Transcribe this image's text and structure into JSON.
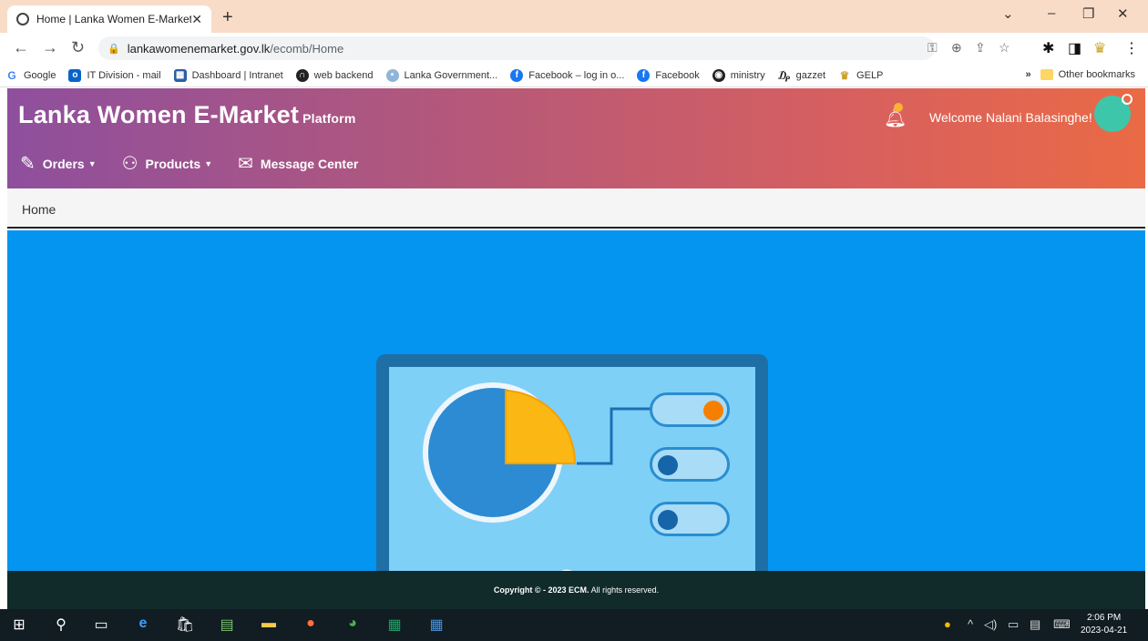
{
  "browser": {
    "tab_title": "Home | Lanka Women E-Market",
    "url_host": "lankawomenemarket.gov.lk",
    "url_path": "/ecomb/Home",
    "bookmarks": [
      "Google",
      "IT Division - mail",
      "Dashboard | Intranet",
      "web backend",
      "Lanka Government...",
      "Facebook – log in o...",
      "Facebook",
      "ministry",
      "gazzet",
      "GELP"
    ],
    "overflow": "»",
    "other_bookmarks": "Other bookmarks"
  },
  "app": {
    "brand": "Lanka Women E-Market",
    "brand_sub": "Platform",
    "welcome": "Welcome Nalani Balasinghe!",
    "menu": {
      "orders": "Orders",
      "products": "Products",
      "messages": "Message Center"
    },
    "breadcrumb": "Home",
    "footer_bold": "Copyright © - 2023 ECM.",
    "footer_rest": " All rights reserved.",
    "colors": {
      "header_start": "#8e4f9d",
      "header_end": "#ea6a45",
      "hero_bg": "#0495f1",
      "footer_bg": "#102b2a",
      "avatar": "#3ec6ab"
    }
  },
  "taskbar": {
    "time": "2:06 PM",
    "date": "2023-04-21"
  }
}
